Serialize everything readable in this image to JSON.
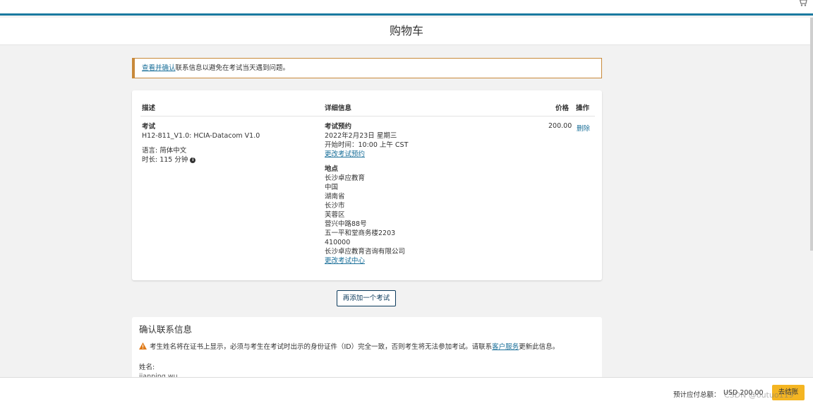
{
  "header": {
    "title": "购物车"
  },
  "alert": {
    "link": "查看并确认",
    "text": "联系信息以避免在考试当天遇到问题。"
  },
  "table": {
    "headers": {
      "description": "描述",
      "details": "详细信息",
      "price": "价格",
      "action": "操作"
    },
    "item": {
      "type": "考试",
      "exam_code": "H12-811_V1.0: HCIA-Datacom V1.0",
      "language": "语言: 简体中文",
      "duration": "时长: 115 分钟",
      "appointment_label": "考试预约",
      "date": "2022年2月23日 星期三",
      "start_time": "开始时间：10:00 上午 CST",
      "change_appointment": "更改考试预约",
      "location_label": "地点",
      "location_lines": [
        "长沙卓应教育",
        "中国",
        "湖南省",
        "长沙市",
        "芙蓉区",
        "营兴中路88号",
        "五一平和堂商务楼2203",
        "410000",
        "长沙卓应教育咨询有限公司"
      ],
      "change_center": "更改考试中心",
      "price": "200.00",
      "delete": "删除"
    }
  },
  "add_exam_button": "再添加一个考试",
  "contact": {
    "title": "确认联系信息",
    "warning_text": "考生姓名将在证书上显示，必须与考生在考试时出示的身份证件（ID）完全一致，否则考生将无法参加考试。请联系",
    "warning_link": "客户服务",
    "warning_tail": "更新此信息。",
    "name_label": "姓名:",
    "name_value": "jianping wu"
  },
  "footer": {
    "total_label": "预计应付总额：",
    "total_value": "USD 200.00",
    "checkout_label": "去结账"
  },
  "watermark": "CSDN @outuo119",
  "colors": {
    "accent": "#1a7aa0",
    "alert_border": "#c8893a",
    "checkout": "#f4b522"
  }
}
